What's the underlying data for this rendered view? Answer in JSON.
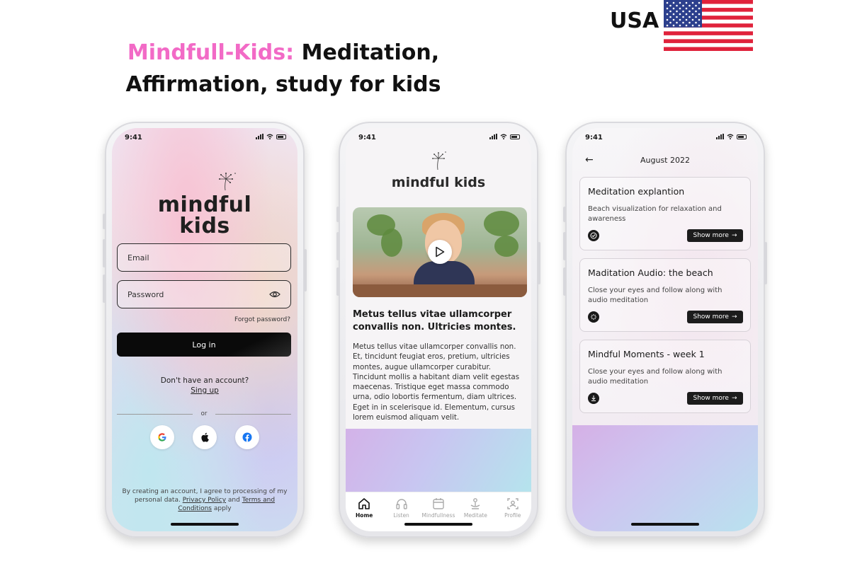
{
  "header": {
    "brand": "Mindfull-Kids:",
    "title_rest": "Meditation, Affirmation, study for kids",
    "country": "USA"
  },
  "colors": {
    "brand_pink": "#f26ac6",
    "dark": "#111111"
  },
  "login_screen": {
    "time": "9:41",
    "logo_line1": "mindful",
    "logo_line2": "kids",
    "email_placeholder": "Email",
    "password_placeholder": "Password",
    "forgot": "Forgot password?",
    "login_button": "Log in",
    "no_account": "Don't have an account?",
    "signup": "Sing up",
    "or": "or",
    "social_icons": [
      "google-icon",
      "apple-icon",
      "facebook-icon"
    ],
    "terms_prefix": "By creating an account, I agree to processing of my personal data.",
    "privacy": "Privacy Policy",
    "and": "and",
    "terms": "Terms and Conditions",
    "apply": "apply"
  },
  "home_screen": {
    "time": "9:41",
    "logo": "mindful kids",
    "headline": "Metus tellus vitae ullamcorper convallis non. Ultricies montes.",
    "body": "Metus tellus vitae ullamcorper convallis non. Et, tincidunt feugiat eros, pretium, ultricies montes, augue ullamcorper curabitur. Tincidunt mollis a habitant diam velit egestas maecenas. Tristique eget massa commodo urna, odio lobortis fermentum, diam ultrices. Eget in in scelerisque id. Elementum, cursus lorem euismod aliquam velit.",
    "tabs": [
      {
        "label": "Home",
        "active": true
      },
      {
        "label": "Listen",
        "active": false
      },
      {
        "label": "Mindfullness",
        "active": false
      },
      {
        "label": "Meditate",
        "active": false
      },
      {
        "label": "Profile",
        "active": false
      }
    ]
  },
  "list_screen": {
    "time": "9:41",
    "title": "August 2022",
    "cards": [
      {
        "title": "Meditation explantion",
        "desc": "Beach visualization for relaxation and awareness",
        "icon": "check-circle-icon",
        "button": "Show more"
      },
      {
        "title": "Maditation Audio: the beach",
        "desc": "Close your eyes and follow along with audio meditation",
        "icon": "loading-spinner-icon",
        "button": "Show more"
      },
      {
        "title": "Mindful Moments - week 1",
        "desc": "Close your eyes and follow along with audio meditation",
        "icon": "download-icon",
        "button": "Show more"
      }
    ]
  }
}
